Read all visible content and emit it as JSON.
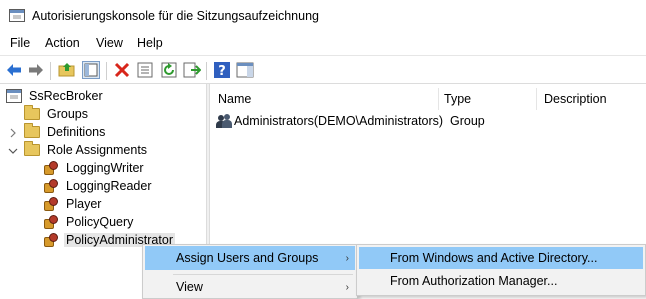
{
  "window": {
    "title": "Autorisierungskonsole für die Sitzungsaufzeichnung",
    "icon": "console-window-icon"
  },
  "menu": {
    "items": [
      "File",
      "Action",
      "View",
      "Help"
    ]
  },
  "toolbar": {
    "buttons": [
      "back-arrow-icon",
      "forward-arrow-icon",
      "folder-up-icon",
      "show-hide-tree-icon",
      "delete-icon",
      "properties-icon",
      "refresh-icon",
      "export-list-icon",
      "help-icon",
      "action-pane-icon"
    ],
    "colors": {
      "back": "#2a6fd1",
      "delete": "#d8261b",
      "refresh": "#2e9a2e",
      "help": "#2f5fbf"
    }
  },
  "tree": {
    "root": "SsRecBroker",
    "groups": "Groups",
    "definitions": "Definitions",
    "role_assignments": "Role Assignments",
    "roles": [
      "LoggingWriter",
      "LoggingReader",
      "Player",
      "PolicyQuery",
      "PolicyAdministrator"
    ],
    "selected": "PolicyAdministrator"
  },
  "list": {
    "columns": {
      "name": "Name",
      "type": "Type",
      "description": "Description"
    },
    "rows": [
      {
        "name": "Administrators(DEMO\\Administrators)",
        "type": "Group",
        "description": ""
      }
    ]
  },
  "context_menu": {
    "items": [
      {
        "label": "Assign Users and Groups",
        "has_submenu": true,
        "highlighted": true
      },
      {
        "label": "View",
        "has_submenu": true,
        "highlighted": false
      }
    ],
    "arrow": "›"
  },
  "submenu": {
    "items": [
      {
        "label": "From Windows and Active Directory...",
        "highlighted": true
      },
      {
        "label": "From Authorization Manager...",
        "highlighted": false
      }
    ]
  },
  "colors": {
    "highlight": "#91c9f7",
    "menu_bg": "#f2f2f2",
    "selected_tree_bg": "#e5e5e5"
  }
}
